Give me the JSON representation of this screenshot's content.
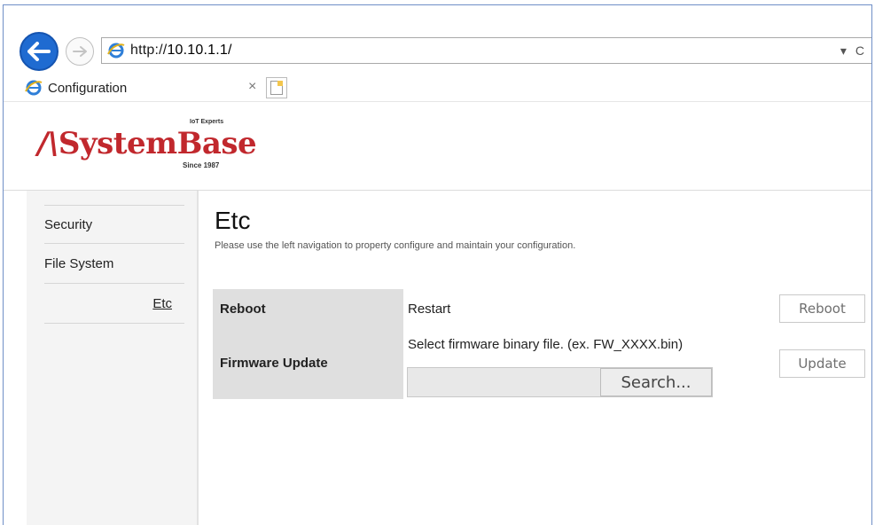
{
  "browser": {
    "url_prefix": "http://",
    "url_host": "10.10.1.1/",
    "addr_dropdown": "▾",
    "refresh": "C",
    "tab_title": "Configuration",
    "tab_close": "×"
  },
  "logo": {
    "slash": "/\\",
    "name": "SystemBase",
    "tagline": "IoT Experts",
    "since": "Since 1987",
    "color": "#c1282d"
  },
  "sidebar": {
    "items": [
      {
        "label": "Security"
      },
      {
        "label": "File System"
      },
      {
        "label": "Etc"
      }
    ]
  },
  "main": {
    "title": "Etc",
    "description": "Please use the left navigation to property configure and maintain your configuration.",
    "rows": {
      "reboot": {
        "label": "Reboot",
        "value": "Restart",
        "button": "Reboot"
      },
      "firmware": {
        "label": "Firmware Update",
        "instruction": "Select firmware binary file. (ex. FW_XXXX.bin)",
        "file_value": "",
        "browse_button": "Search...",
        "button": "Update"
      }
    }
  },
  "colors": {
    "accent_blue": "#1f6bd1",
    "label_bg": "#dfdfdf",
    "sidebar_bg": "#f4f4f4"
  }
}
